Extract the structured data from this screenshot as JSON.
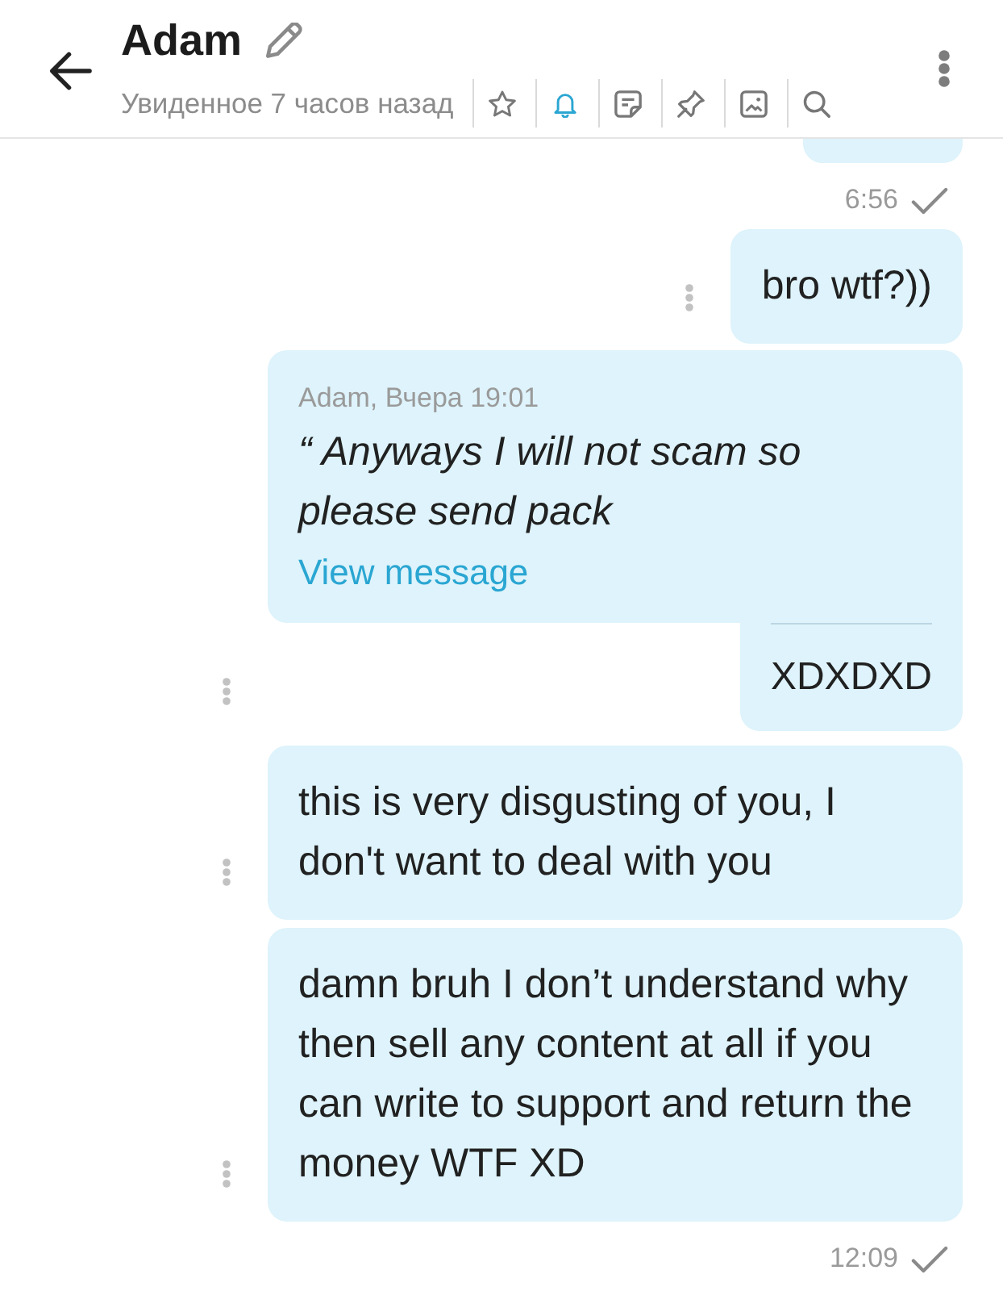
{
  "header": {
    "title": "Adam",
    "subtitle": "Увиденное 7 часов назад",
    "toolbar": [
      {
        "kind": "star",
        "on": false
      },
      {
        "kind": "bell",
        "on": true
      },
      {
        "kind": "note",
        "on": false
      },
      {
        "kind": "pin",
        "on": false
      },
      {
        "kind": "image",
        "on": false
      },
      {
        "kind": "search",
        "on": false
      }
    ]
  },
  "messages": [
    {
      "kind": "clipped"
    },
    {
      "kind": "time",
      "time": "6:56"
    },
    {
      "kind": "text",
      "text": "bro wtf?))"
    },
    {
      "kind": "reply",
      "quote": {
        "byline": "Adam, Вчера 19:01",
        "text": "“ Anyways I will not scam so please send pack",
        "link": "View message"
      },
      "text": "XDXDXD"
    },
    {
      "kind": "text",
      "text": "this is very disgusting of you, I don't want to deal with you"
    },
    {
      "kind": "text",
      "text": "damn bruh I don’t understand why then sell any content at all if you can write to support and return the money WTF XD"
    },
    {
      "kind": "time",
      "time": "12:09"
    }
  ]
}
